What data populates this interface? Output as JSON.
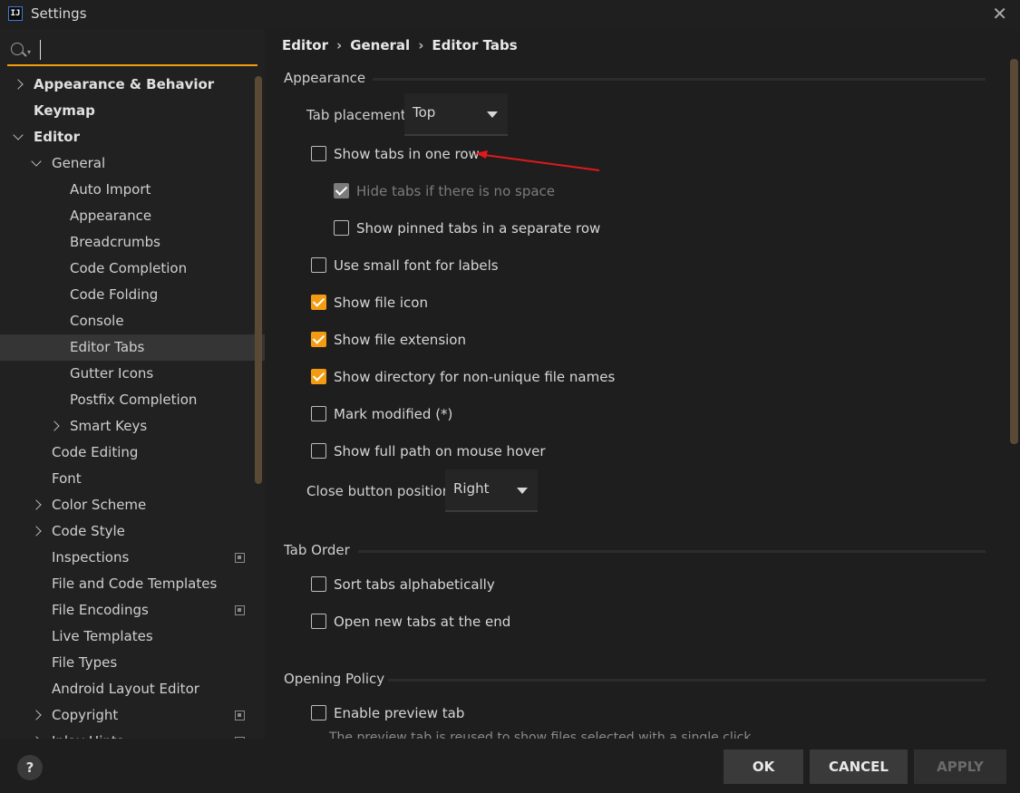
{
  "window": {
    "title": "Settings",
    "app_icon_text": "IJ"
  },
  "search": {
    "value": "",
    "placeholder": ""
  },
  "sidebar": {
    "items": [
      {
        "label": "Appearance & Behavior",
        "level": 0,
        "bold": true,
        "chevron": "right",
        "proj": false
      },
      {
        "label": "Keymap",
        "level": 0,
        "bold": true,
        "chevron": "none",
        "proj": false
      },
      {
        "label": "Editor",
        "level": 0,
        "bold": true,
        "chevron": "down",
        "proj": false
      },
      {
        "label": "General",
        "level": 1,
        "bold": false,
        "chevron": "down",
        "proj": false
      },
      {
        "label": "Auto Import",
        "level": 2,
        "bold": false,
        "chevron": "none",
        "proj": false
      },
      {
        "label": "Appearance",
        "level": 2,
        "bold": false,
        "chevron": "none",
        "proj": false
      },
      {
        "label": "Breadcrumbs",
        "level": 2,
        "bold": false,
        "chevron": "none",
        "proj": false
      },
      {
        "label": "Code Completion",
        "level": 2,
        "bold": false,
        "chevron": "none",
        "proj": false
      },
      {
        "label": "Code Folding",
        "level": 2,
        "bold": false,
        "chevron": "none",
        "proj": false
      },
      {
        "label": "Console",
        "level": 2,
        "bold": false,
        "chevron": "none",
        "proj": false
      },
      {
        "label": "Editor Tabs",
        "level": 2,
        "bold": false,
        "chevron": "none",
        "proj": false,
        "selected": true
      },
      {
        "label": "Gutter Icons",
        "level": 2,
        "bold": false,
        "chevron": "none",
        "proj": false
      },
      {
        "label": "Postfix Completion",
        "level": 2,
        "bold": false,
        "chevron": "none",
        "proj": false
      },
      {
        "label": "Smart Keys",
        "level": 2,
        "bold": false,
        "chevron": "right",
        "proj": false
      },
      {
        "label": "Code Editing",
        "level": 1,
        "bold": false,
        "chevron": "none",
        "proj": false
      },
      {
        "label": "Font",
        "level": 1,
        "bold": false,
        "chevron": "none",
        "proj": false
      },
      {
        "label": "Color Scheme",
        "level": 1,
        "bold": false,
        "chevron": "right",
        "proj": false
      },
      {
        "label": "Code Style",
        "level": 1,
        "bold": false,
        "chevron": "right",
        "proj": false
      },
      {
        "label": "Inspections",
        "level": 1,
        "bold": false,
        "chevron": "none",
        "proj": true
      },
      {
        "label": "File and Code Templates",
        "level": 1,
        "bold": false,
        "chevron": "none",
        "proj": false
      },
      {
        "label": "File Encodings",
        "level": 1,
        "bold": false,
        "chevron": "none",
        "proj": true
      },
      {
        "label": "Live Templates",
        "level": 1,
        "bold": false,
        "chevron": "none",
        "proj": false
      },
      {
        "label": "File Types",
        "level": 1,
        "bold": false,
        "chevron": "none",
        "proj": false
      },
      {
        "label": "Android Layout Editor",
        "level": 1,
        "bold": false,
        "chevron": "none",
        "proj": false
      },
      {
        "label": "Copyright",
        "level": 1,
        "bold": false,
        "chevron": "right",
        "proj": true
      },
      {
        "label": "Inlay Hints",
        "level": 1,
        "bold": false,
        "chevron": "right",
        "proj": true
      }
    ]
  },
  "breadcrumb": [
    "Editor",
    "General",
    "Editor Tabs"
  ],
  "sections": {
    "appearance": "Appearance",
    "tab_order": "Tab Order",
    "opening_policy": "Opening Policy"
  },
  "tab_placement": {
    "label": "Tab placement:",
    "value": "Top"
  },
  "close_button_position": {
    "label": "Close button position:",
    "value": "Right"
  },
  "options": {
    "show_tabs_one_row": {
      "label": "Show tabs in one row",
      "checked": false,
      "disabled": false
    },
    "hide_tabs_no_space": {
      "label": "Hide tabs if there is no space",
      "checked": true,
      "disabled": true
    },
    "show_pinned_separate": {
      "label": "Show pinned tabs in a separate row",
      "checked": false,
      "disabled": false
    },
    "small_font_labels": {
      "label": "Use small font for labels",
      "checked": false,
      "disabled": false
    },
    "show_file_icon": {
      "label": "Show file icon",
      "checked": true,
      "disabled": false
    },
    "show_file_extension": {
      "label": "Show file extension",
      "checked": true,
      "disabled": false
    },
    "show_directory": {
      "label": "Show directory for non-unique file names",
      "checked": true,
      "disabled": false
    },
    "mark_modified": {
      "label": "Mark modified (*)",
      "checked": false,
      "disabled": false
    },
    "show_full_path": {
      "label": "Show full path on mouse hover",
      "checked": false,
      "disabled": false
    },
    "sort_alphabetically": {
      "label": "Sort tabs alphabetically",
      "checked": false,
      "disabled": false
    },
    "open_at_end": {
      "label": "Open new tabs at the end",
      "checked": false,
      "disabled": false
    },
    "enable_preview": {
      "label": "Enable preview tab",
      "checked": false,
      "disabled": false
    }
  },
  "preview_hint": "The preview tab is reused to show files selected with a single click",
  "footer": {
    "help": "?",
    "ok": "OK",
    "cancel": "CANCEL",
    "apply": "APPLY"
  },
  "colors": {
    "accent": "#f39c12",
    "annotation": "#e0191a",
    "background": "#1e1e1e",
    "sidebar": "#212121",
    "selected": "#353535"
  }
}
